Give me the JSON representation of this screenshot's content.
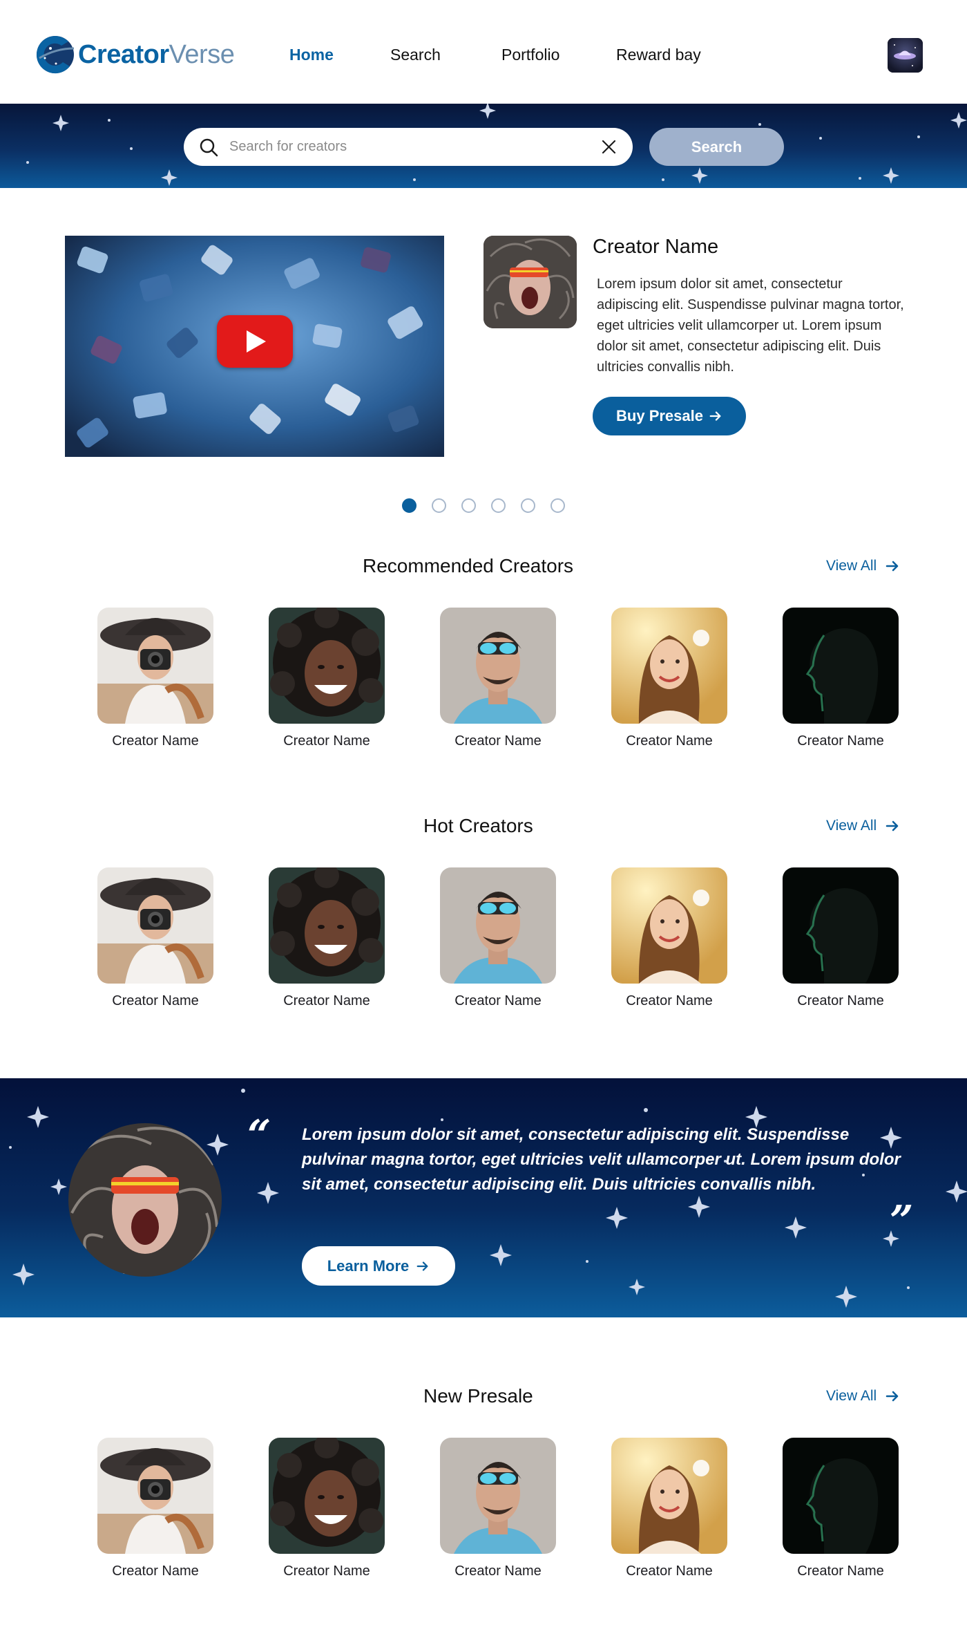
{
  "brand": {
    "part1": "Creator",
    "part2": "Verse"
  },
  "nav": [
    {
      "label": "Home",
      "active": true
    },
    {
      "label": "Search",
      "active": false
    },
    {
      "label": "Portfolio",
      "active": false
    },
    {
      "label": "Reward bay",
      "active": false
    }
  ],
  "search": {
    "placeholder": "Search for creators",
    "value": "",
    "button_label": "Search"
  },
  "featured": {
    "name": "Creator Name",
    "description": "Lorem ipsum dolor sit amet, consectetur adipiscing elit. Suspendisse pulvinar magna tortor, eget ultricies velit ullamcorper ut. Lorem ipsum dolor sit amet, consectetur adipiscing elit. Duis ultricies convallis nibh.",
    "button_label": "Buy Presale",
    "carousel_total": 6,
    "carousel_active": 1
  },
  "sections": {
    "recommended": {
      "title": "Recommended Creators",
      "view_all": "View All",
      "creators": [
        "Creator Name",
        "Creator Name",
        "Creator Name",
        "Creator Name",
        "Creator Name"
      ]
    },
    "hot": {
      "title": "Hot Creators",
      "view_all": "View All",
      "creators": [
        "Creator Name",
        "Creator Name",
        "Creator Name",
        "Creator Name",
        "Creator Name"
      ]
    },
    "new_presale": {
      "title": "New Presale",
      "view_all": "View All",
      "creators": [
        "Creator Name",
        "Creator Name",
        "Creator Name",
        "Creator Name",
        "Creator Name"
      ]
    }
  },
  "testimonial": {
    "quote_open": "“",
    "quote_close": "”",
    "text": "Lorem ipsum dolor sit amet, consectetur adipiscing elit. Suspendisse pulvinar magna tortor, eget ultricies velit ullamcorper ut. Lorem ipsum dolor sit amet, consectetur adipiscing elit. Duis ultricies convallis nibh.",
    "button_label": "Learn More"
  },
  "colors": {
    "primary": "#0a5f9d",
    "search_button": "#9fb1cc",
    "banner_dark": "#07163a",
    "play_red": "#e21a1a"
  },
  "icons": [
    "logo-icon",
    "user-avatar-icon",
    "search-icon",
    "close-icon",
    "play-icon",
    "arrow-right-icon"
  ]
}
